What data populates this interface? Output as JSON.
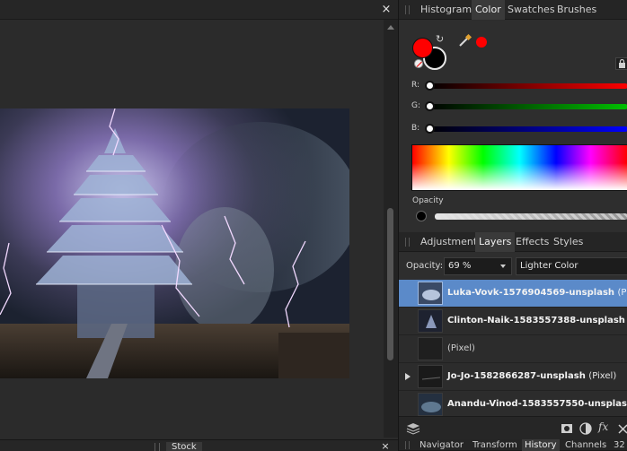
{
  "canvas": {
    "close_symbol": "×",
    "stock_tab": "Stock",
    "stock_close_symbol": "×"
  },
  "color_panel": {
    "tabs": [
      {
        "label": "Histogram",
        "active": false
      },
      {
        "label": "Color",
        "active": true
      },
      {
        "label": "Swatches",
        "active": false
      },
      {
        "label": "Brushes",
        "active": false
      }
    ],
    "fill_color": "#ff0000",
    "stroke_color": "#000000",
    "picked_color": "#ff0000",
    "sliders": [
      {
        "label": "R:",
        "value": 0,
        "end_color": "#ff0000"
      },
      {
        "label": "G:",
        "value": 0,
        "end_color": "#00c000"
      },
      {
        "label": "B:",
        "value": 0,
        "end_color": "#0000ff"
      }
    ],
    "opacity_label": "Opacity"
  },
  "layers_panel": {
    "tabs": [
      {
        "label": "Adjustment",
        "active": false
      },
      {
        "label": "Layers",
        "active": true
      },
      {
        "label": "Effects",
        "active": false
      },
      {
        "label": "Styles",
        "active": false
      }
    ],
    "opacity_label": "Opacity:",
    "opacity_value": "69 %",
    "blend_mode": "Lighter Color",
    "layers": [
      {
        "name": "Luka-Vovk-1576904569-unsplash",
        "type": "(P",
        "selected": true
      },
      {
        "name": "Clinton-Naik-1583557388-unsplash",
        "type": "",
        "selected": false
      },
      {
        "name": "",
        "type": "(Pixel)",
        "selected": false
      },
      {
        "name": "Jo-Jo-1582866287-unsplash",
        "type": "(Pixel)",
        "selected": false
      },
      {
        "name": "Anandu-Vinod-1583557550-unsplas",
        "type": "",
        "selected": false
      }
    ]
  },
  "bottom_panel": {
    "tabs": [
      {
        "label": "Navigator",
        "active": false
      },
      {
        "label": "Transform",
        "active": false
      },
      {
        "label": "History",
        "active": true
      },
      {
        "label": "Channels",
        "active": false
      },
      {
        "label": "32",
        "active": false
      }
    ]
  }
}
